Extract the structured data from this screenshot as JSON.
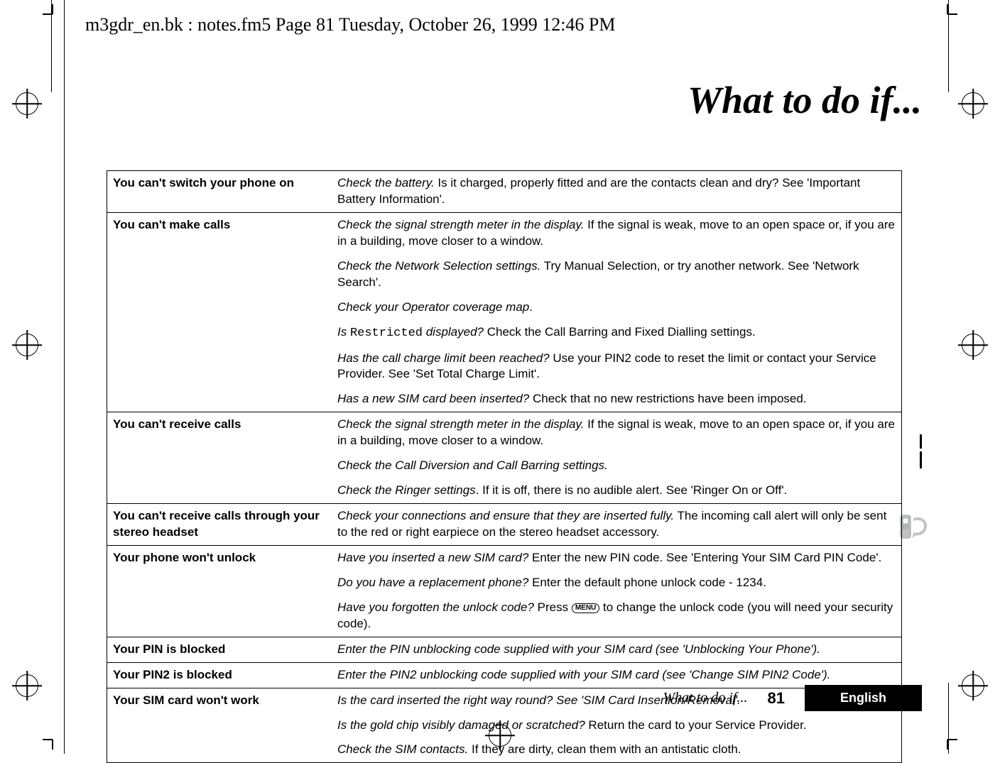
{
  "running_head": "m3gdr_en.bk : notes.fm5  Page 81  Tuesday, October 26, 1999  12:46 PM",
  "chapter_title": "What to do if...",
  "rows": [
    {
      "section_start": true,
      "header": "You can't switch your phone on",
      "body_prefix_italic": "Check the battery.",
      "body_rest": " Is it charged, properly fitted and are the contacts clean and dry? See 'Important Battery Information'."
    },
    {
      "section_start": true,
      "header": "You can't make calls",
      "body_prefix_italic": "Check the signal strength meter in the display.",
      "body_rest": " If the signal is weak, move to an open space or, if you are in a building, move closer to a window."
    },
    {
      "body_prefix_italic": "Check the Network Selection settings.",
      "body_rest": " Try Manual Selection, or try another network. See 'Network Search'."
    },
    {
      "body_prefix_italic": "Check your Operator coverage map",
      "body_rest": "."
    },
    {
      "body_prefix_italic": "Is ",
      "mono": "Restricted",
      "body_mid_italic": " displayed?",
      "body_rest": " Check the Call Barring and Fixed Dialling settings."
    },
    {
      "body_prefix_italic": "Has the call charge limit been reached?",
      "body_rest": " Use your PIN2 code to reset the limit or contact your Service Provider. See 'Set Total Charge Limit'."
    },
    {
      "body_prefix_italic": "Has a new SIM card been inserted?",
      "body_rest": " Check that no new restrictions have been imposed."
    },
    {
      "section_start": true,
      "header": "You can't receive calls",
      "body_prefix_italic": "Check the signal strength meter in the display.",
      "body_rest": " If the signal is weak, move to an open space or, if you are in a building, move closer to a window."
    },
    {
      "body_prefix_italic": "Check the Call Diversion and Call Barring settings.",
      "body_rest": ""
    },
    {
      "body_prefix_italic": "Check the Ringer settings",
      "body_rest": ". If it is off, there is no audible alert. See 'Ringer On or Off'."
    },
    {
      "section_start": true,
      "header": "You can't receive calls through your stereo headset",
      "body_prefix_italic": "Check your connections and ensure that they are inserted fully.",
      "body_rest": " The incoming call alert will only be sent to the red or right earpiece on the stereo headset accessory."
    },
    {
      "section_start": true,
      "header": "Your phone won't unlock",
      "body_prefix_italic": "Have you inserted a new SIM card?",
      "body_rest": " Enter the new PIN code. See 'Entering Your SIM Card PIN Code'."
    },
    {
      "body_prefix_italic": "Do you have a replacement phone?",
      "body_rest": " Enter the default phone unlock code - 1234."
    },
    {
      "body_prefix_italic": "Have you forgotten the unlock code?",
      "body_rest_before_pill": " Press ",
      "pill": "MENU",
      "body_rest_after_pill": " to change the unlock code (you will need your security code)."
    },
    {
      "section_start": true,
      "header": "Your PIN is blocked",
      "body_prefix_italic": "Enter the PIN unblocking code supplied with your SIM card (see 'Unblocking Your Phone').",
      "body_rest": ""
    },
    {
      "section_start": true,
      "header": "Your PIN2 is blocked",
      "body_prefix_italic": "Enter the PIN2 unblocking code supplied with your SIM card (see 'Change SIM PIN2 Code').",
      "body_rest": ""
    },
    {
      "section_start": true,
      "header": "Your SIM card won't work",
      "body_prefix_italic": "Is the card inserted the right way round? See 'SIM Card Insertion/Removal'.",
      "body_rest": ""
    },
    {
      "body_prefix_italic": "Is the gold chip visibly damaged or scratched?",
      "body_rest": " Return the card to your Service Provider."
    },
    {
      "last": true,
      "body_prefix_italic": "Check the SIM contacts.",
      "body_rest": " If they are dirty, clean them with an antistatic cloth."
    }
  ],
  "footer": {
    "section_title": "What to do if...",
    "page_number": "81",
    "language": "English"
  }
}
